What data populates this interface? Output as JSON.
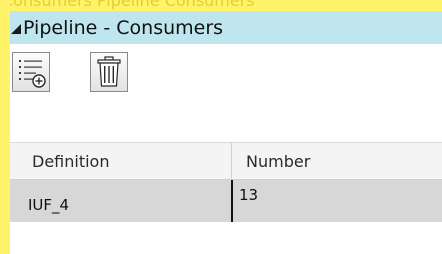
{
  "background_ghost_text": "Consumers Pipeline Consumers",
  "panel": {
    "title": "Pipeline - Consumers"
  },
  "toolbar": {
    "buttons": [
      {
        "name": "add-consumer",
        "icon": "list-add-icon"
      },
      {
        "name": "delete-consumer",
        "icon": "trash-icon"
      }
    ]
  },
  "grid": {
    "columns": [
      "Definition",
      "Number"
    ],
    "rows": [
      {
        "definition": "IUF_4",
        "number": "13"
      }
    ]
  },
  "colors": {
    "header_bg": "#bfe6ef",
    "highlight_yellow": "#fff36a",
    "selected_row": "#d7d7d7"
  }
}
